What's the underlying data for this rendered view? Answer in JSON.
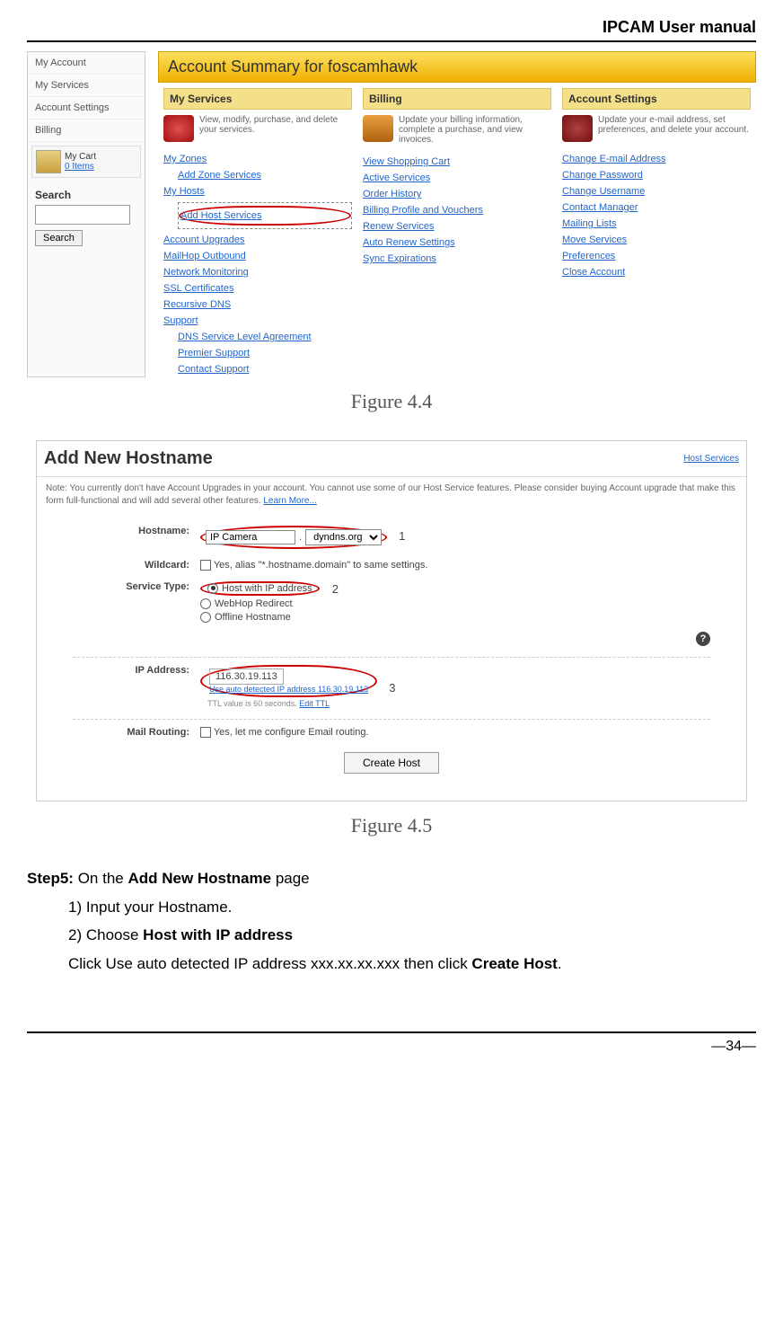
{
  "header": {
    "title": "IPCAM User manual"
  },
  "footer": {
    "page": "—34—"
  },
  "fig44": {
    "sidebar": {
      "items": [
        "My Account",
        "My Services",
        "Account Settings",
        "Billing"
      ],
      "cart": {
        "label": "My Cart",
        "count": "0 Items"
      },
      "search": {
        "heading": "Search",
        "button": "Search"
      }
    },
    "title": "Account Summary for foscamhawk",
    "cols": {
      "services": {
        "header": "My Services",
        "desc": "View, modify, purchase, and delete your services.",
        "links": [
          "My Zones",
          "Add Zone Services",
          "My Hosts",
          "Add Host Services",
          "Account Upgrades",
          "MailHop Outbound",
          "Network Monitoring",
          "SSL Certificates",
          "Recursive DNS",
          "Support",
          "DNS Service Level Agreement",
          "Premier Support",
          "Contact Support"
        ]
      },
      "billing": {
        "header": "Billing",
        "desc": "Update your billing information, complete a purchase, and view invoices.",
        "links": [
          "View Shopping Cart",
          "Active Services",
          "Order History",
          "Billing Profile and Vouchers",
          "Renew Services",
          "Auto Renew Settings",
          "Sync Expirations"
        ]
      },
      "settings": {
        "header": "Account Settings",
        "desc": "Update your e-mail address, set preferences, and delete your account.",
        "links": [
          "Change E-mail Address",
          "Change Password",
          "Change Username",
          "Contact Manager",
          "Mailing Lists",
          "Move Services",
          "Preferences",
          "Close Account"
        ]
      }
    },
    "caption": "Figure 4.4"
  },
  "fig45": {
    "title": "Add New Hostname",
    "host_services": "Host Services",
    "note": "Note: You currently don't have Account Upgrades in your account. You cannot use some of our Host Service features. Please consider buying Account upgrade that make this form full-functional and will add several other features.",
    "learn_more": "Learn More...",
    "form": {
      "hostname": {
        "label": "Hostname:",
        "value": "IP Camera",
        "domain": "dyndns.org",
        "callout": "1"
      },
      "wildcard": {
        "label": "Wildcard:",
        "text": "Yes, alias \"*.hostname.domain\" to same settings."
      },
      "service": {
        "label": "Service Type:",
        "opt1": "Host with IP address",
        "opt2": "WebHop Redirect",
        "opt3": "Offline Hostname",
        "callout": "2"
      },
      "ip": {
        "label": "IP Address:",
        "value": "116.30.19.113",
        "auto": "Use auto detected IP address 116.30.19.113",
        "ttl": "TTL value is 60 seconds.",
        "edit": "Edit TTL",
        "callout": "3"
      },
      "mail": {
        "label": "Mail Routing:",
        "text": "Yes, let me configure Email routing."
      },
      "create": "Create Host"
    },
    "caption": "Figure 4.5"
  },
  "body": {
    "step5_label": "Step5:",
    "step5_text": " On the ",
    "step5_bold": "Add New Hostname",
    "step5_end": " page",
    "item1": "1)  Input your Hostname.",
    "item2a": "2)  Choose ",
    "item2b": "Host with IP address",
    "line3a": "Click Use auto detected IP address xxx.xx.xx.xxx then click ",
    "line3b": "Create Host",
    "line3c": "."
  }
}
